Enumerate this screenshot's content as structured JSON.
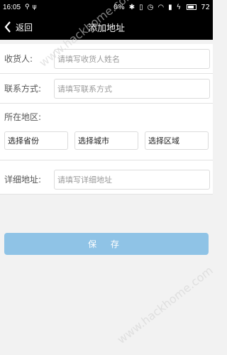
{
  "status_bar": {
    "time": "16:05",
    "left_icons": [
      "usb-tether-icon",
      "usb-icon"
    ],
    "data_rate": "0%",
    "battery": "72"
  },
  "navbar": {
    "back_label": "返回",
    "title": "添加地址"
  },
  "form": {
    "recipient": {
      "label": "收货人:",
      "placeholder": "请填写收货人姓名"
    },
    "phone": {
      "label": "联系方式:",
      "placeholder": "请填写联系方式"
    },
    "region": {
      "label": "所在地区:",
      "province": "选择省份",
      "city": "选择城市",
      "district": "选择区域"
    },
    "address": {
      "label": "详细地址:",
      "placeholder": "请填写详细地址"
    }
  },
  "save_button": {
    "label": "保 存"
  },
  "watermark": "www.hackhome.com",
  "colors": {
    "header_bg": "#000000",
    "save_button_bg": "#8fc3e6",
    "page_bg": "#f2f2f2"
  }
}
